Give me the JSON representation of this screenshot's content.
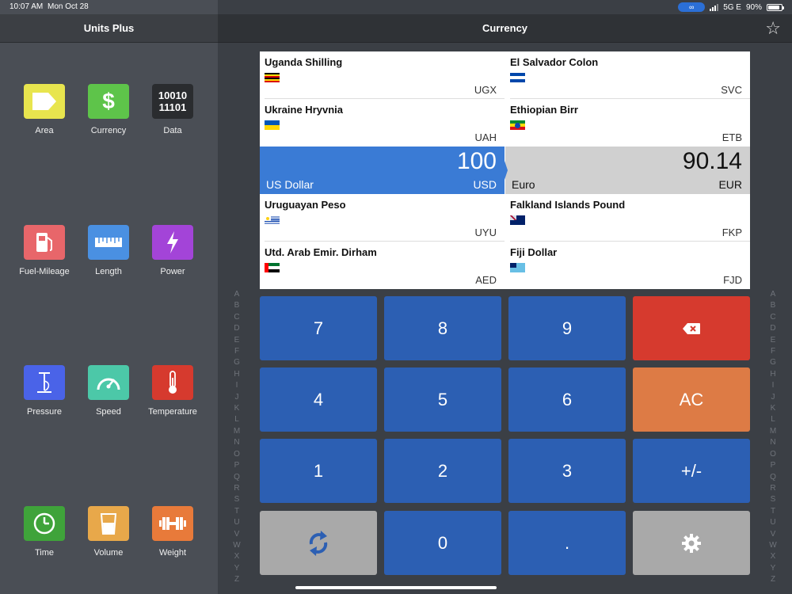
{
  "status": {
    "time": "10:07 AM",
    "date": "Mon Oct 28",
    "network": "5G E",
    "battery_text": "90%",
    "battery_level": 0.9
  },
  "sidebar": {
    "title": "Units Plus",
    "categories": [
      {
        "label": "Area",
        "icon": "area-icon",
        "color": "#e8e54e"
      },
      {
        "label": "Currency",
        "icon": "dollar-icon",
        "color": "#5ec44a",
        "glyph": "$"
      },
      {
        "label": "Data",
        "icon": "binary-icon",
        "color": "#2a2c2f",
        "glyph_top": "10010",
        "glyph_bottom": "11101"
      },
      {
        "label": "Fuel-Mileage",
        "icon": "fuel-pump-icon",
        "color": "#e8666a"
      },
      {
        "label": "Length",
        "icon": "ruler-icon",
        "color": "#4a90e2"
      },
      {
        "label": "Power",
        "icon": "lightning-icon",
        "color": "#a344d8"
      },
      {
        "label": "Pressure",
        "icon": "pressure-gauge-icon",
        "color": "#4a63e8"
      },
      {
        "label": "Speed",
        "icon": "speedometer-icon",
        "color": "#4cc8a8"
      },
      {
        "label": "Temperature",
        "icon": "thermometer-icon",
        "color": "#d63a2e"
      },
      {
        "label": "Time",
        "icon": "clock-icon",
        "color": "#3fa33a"
      },
      {
        "label": "Volume",
        "icon": "beaker-icon",
        "color": "#e8a84a"
      },
      {
        "label": "Weight",
        "icon": "dumbbell-icon",
        "color": "#e87a3a"
      }
    ]
  },
  "main": {
    "title": "Currency",
    "favorite_icon": "star-icon"
  },
  "currencies": {
    "left": [
      {
        "name": "Uganda Shilling",
        "code": "UGX",
        "flag": "uganda"
      },
      {
        "name": "Ukraine Hryvnia",
        "code": "UAH",
        "flag": "ukraine"
      },
      {
        "name": "US Dollar",
        "code": "USD",
        "value": "100",
        "selected": true
      },
      {
        "name": "Uruguayan Peso",
        "code": "UYU",
        "flag": "uruguay"
      },
      {
        "name": "Utd. Arab Emir. Dirham",
        "code": "AED",
        "flag": "uae"
      }
    ],
    "right": [
      {
        "name": "El Salvador Colon",
        "code": "SVC",
        "flag": "elsalvador"
      },
      {
        "name": "Ethiopian Birr",
        "code": "ETB",
        "flag": "ethiopia"
      },
      {
        "name": "Euro",
        "code": "EUR",
        "value": "90.14",
        "selected": true
      },
      {
        "name": "Falkland Islands Pound",
        "code": "FKP",
        "flag": "falkland"
      },
      {
        "name": "Fiji Dollar",
        "code": "FJD",
        "flag": "fiji"
      }
    ]
  },
  "alphabet": [
    "A",
    "B",
    "C",
    "D",
    "E",
    "F",
    "G",
    "H",
    "I",
    "J",
    "K",
    "L",
    "M",
    "N",
    "O",
    "P",
    "Q",
    "R",
    "S",
    "T",
    "U",
    "V",
    "W",
    "X",
    "Y",
    "Z"
  ],
  "keypad": {
    "k7": "7",
    "k8": "8",
    "k9": "9",
    "k4": "4",
    "k5": "5",
    "k6": "6",
    "ac": "AC",
    "k1": "1",
    "k2": "2",
    "k3": "3",
    "sign": "+/-",
    "k0": "0",
    "dot": ".",
    "backspace_icon": "backspace-icon",
    "swap_icon": "swap-icon",
    "settings_icon": "gear-icon"
  },
  "colors": {
    "accent_blue": "#3a7bd5",
    "key_blue": "#2c5fb3",
    "key_red": "#d63a2e",
    "key_orange": "#dd7b45"
  }
}
